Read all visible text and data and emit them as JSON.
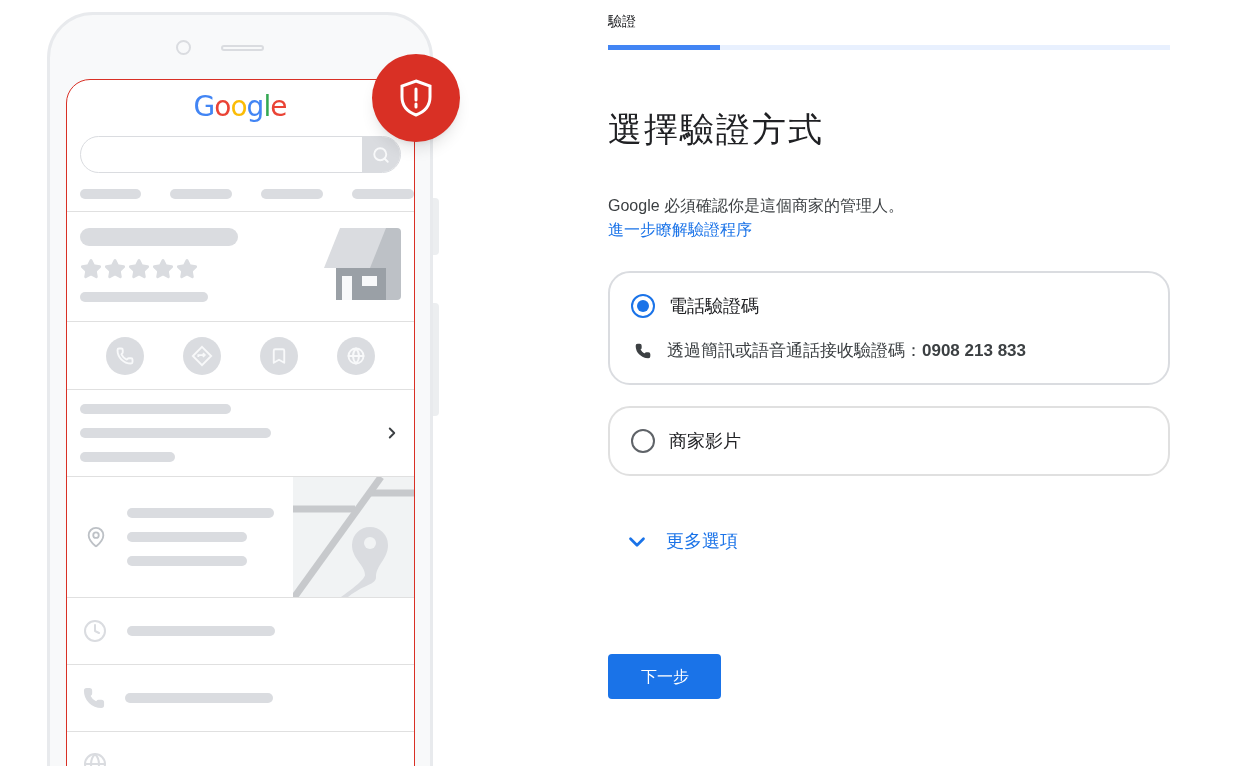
{
  "phone_illustration": {
    "logo": "Google"
  },
  "stepper": {
    "label": "驗證",
    "level": 0.2
  },
  "title": "選擇驗證方式",
  "description": "Google 必須確認你是這個商家的管理人。",
  "learn_more_link": "進一步瞭解驗證程序",
  "options": [
    {
      "label": "電話驗證碼",
      "selected": true,
      "detail": "透過簡訊或語音通話接收驗證碼：**0908 213 833**"
    },
    {
      "label": "商家影片",
      "selected": false
    }
  ],
  "more_options": {
    "label": "更多選項",
    "expanded": false
  },
  "next_button": "下一步"
}
